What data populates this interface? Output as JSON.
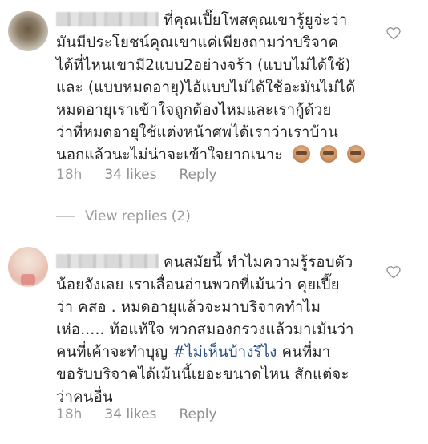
{
  "comments": [
    {
      "lines": [
        "ที่คุณเปี๊ยโพสคุณเขารู้ยูจ่ะว่า",
        "มันมีประโยชน์คุณเขาแค่เพียงถามว่าบริจาค",
        "ได้ที่ไหนเขามี2แบบ2อย่างจร้า (แบบไม่ได้ใช้)",
        "และ (แบบหมดอายุ)ไอ้แบบไม่ได้ใช้อะมันไม่ได้",
        "หมดอายุเราเข้าใจถูกต้องไหมและเรากู้ด้วย",
        "ว่าที่หมดอายุใช้แต่งหน้าศพได้เราว่าเราบ้าน",
        "นอกแล้วนะไม่น่าจะเข้าใจยากเนาะ"
      ],
      "time": "18h",
      "likes": "34 likes",
      "reply_label": "Reply",
      "view_replies": "View replies (2)"
    },
    {
      "lines": [
        "คนสมัยนี้ ทำไมความรู้รอบตัว",
        "น้อยจังเลย เราเลื่อนอ่านพวกที่เม้นว่า คุยเปี๊ย",
        "ว่า คสอ . หมดอายุแล้วจะมาบริจาคทำไม",
        "เห่อ..... ท้อแท้ใจ พวกสมองกรวงแล้วมาเม้นว่า",
        "คนที่เค้าจะทำบุญ",
        "ขอรับบริจาคได้เม้นนี้เยอะขนาดไหน สักแต่จะ",
        "ว่าคนอื่น"
      ],
      "hashtag": "#ไม่เห็นบ้างรึไง",
      "after_hashtag": "คนที่มา",
      "time": "18h",
      "likes": "34 likes",
      "reply_label": "Reply"
    }
  ],
  "icons": {
    "like": "heart-outline-icon",
    "emoji": "see-no-evil-monkey-icon"
  },
  "colors": {
    "text": "#262626",
    "meta": "#8e8e8e",
    "hashtag": "#2a4f85"
  }
}
